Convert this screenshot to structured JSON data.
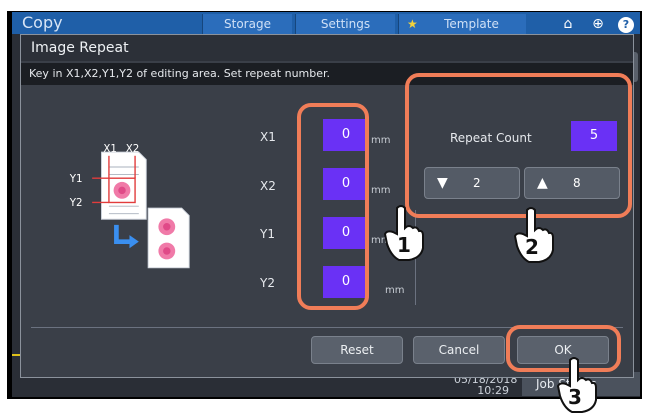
{
  "header": {
    "app_title": "Copy",
    "tabs": [
      "Storage",
      "Settings",
      "Template"
    ]
  },
  "dialog": {
    "title": "Image Repeat",
    "message": "Key in X1,X2,Y1,Y2 of editing area. Set repeat number.",
    "fields": [
      {
        "label": "X1",
        "value": "0",
        "unit": "mm"
      },
      {
        "label": "X2",
        "value": "0",
        "unit": "mm"
      },
      {
        "label": "Y1",
        "value": "0",
        "unit": "mm"
      },
      {
        "label": "Y2",
        "value": "0",
        "unit": "mm"
      }
    ],
    "repeat": {
      "label": "Repeat Count",
      "value": "5",
      "down_value": "2",
      "up_value": "8"
    },
    "buttons": {
      "reset": "Reset",
      "cancel": "Cancel",
      "ok": "OK"
    }
  },
  "illustration": {
    "labels": [
      "X1",
      "X2",
      "Y1",
      "Y2"
    ]
  },
  "callouts": [
    "1",
    "2",
    "3"
  ],
  "footer": {
    "date": "05/18/2018",
    "time": "10:29",
    "job_status": "Job Status"
  },
  "colors": {
    "highlight": "#f07d58",
    "field": "#6a31f5",
    "title_bar": "#1f5fa8"
  }
}
